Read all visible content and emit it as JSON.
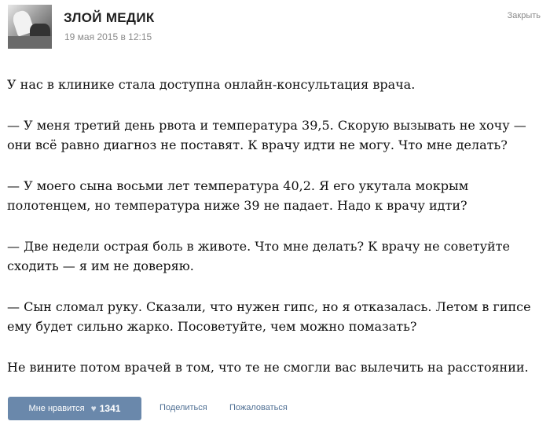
{
  "header": {
    "group_name": "ЗЛОЙ МЕДИК",
    "date": "19 мая 2015 в 12:15",
    "close_label": "Закрыть"
  },
  "post": {
    "paragraphs": [
      "У нас в клинике стала доступна онлайн-консультация врача.",
      "— У меня третий день рвота и температура 39,5. Скорую вызывать не хочу —\nони всё равно диагноз не поставят. К врачу идти не могу. Что мне делать?",
      "— У моего сына восьми лет температура 40,2. Я его укутала мокрым\nполотенцем, но температура ниже 39 не падает. Надо к врачу идти?",
      "— Две недели острая боль в животе. Что мне делать? К врачу не советуйте\nсходить — я им не доверяю.",
      "— Сын сломал руку. Сказали, что нужен гипс, но я отказалась. Летом в гипсе\nему будет сильно жарко. Посоветуйте, чем можно помазать?",
      "Не вините потом врачей в том, что те не смогли вас вылечить на расстоянии."
    ]
  },
  "footer": {
    "like_label": "Мне нравится",
    "like_icon": "heart-icon",
    "like_count": "1341",
    "share_label": "Поделиться",
    "report_label": "Пожаловаться"
  },
  "colors": {
    "like_button_bg": "#6a88ab",
    "link": "#4f6f93",
    "muted": "#8a8a8a"
  }
}
